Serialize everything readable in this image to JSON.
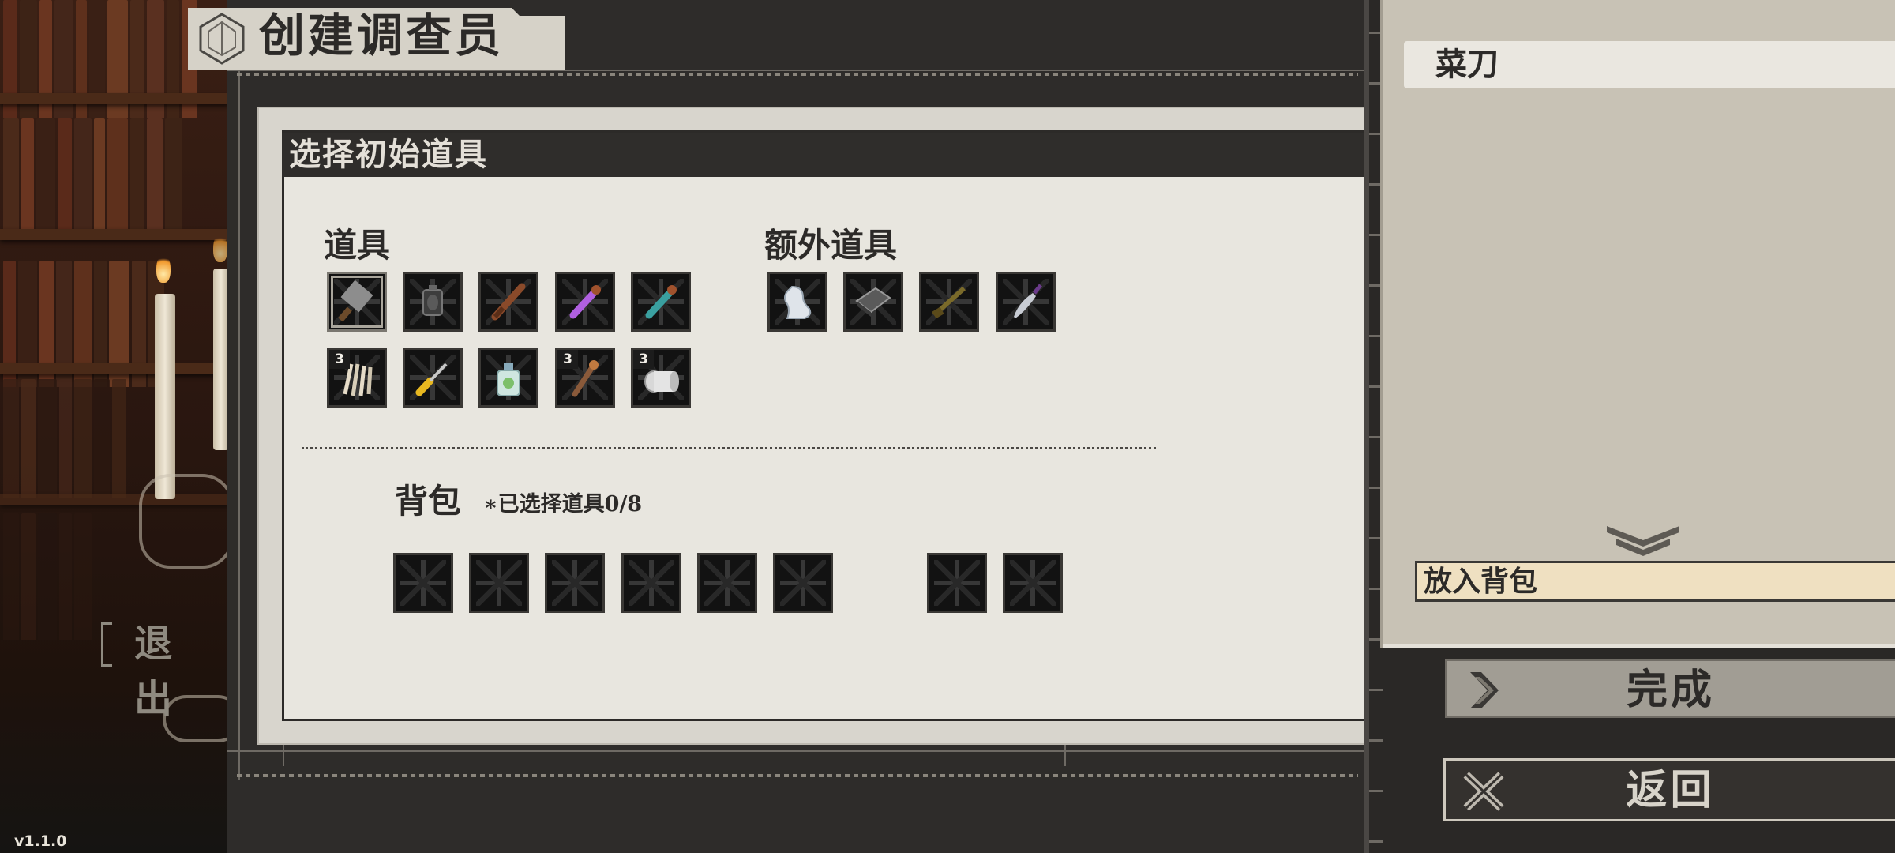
{
  "header": {
    "title": "创建调查员"
  },
  "left": {
    "exit_label": "退出",
    "version": "v1.1.0"
  },
  "dialog": {
    "title": "选择初始道具",
    "items_label": "道具",
    "extra_items_label": "额外道具",
    "items": [
      {
        "name": "cleaver-icon",
        "badge": ""
      },
      {
        "name": "lantern-icon",
        "badge": ""
      },
      {
        "name": "wooden-club-icon",
        "badge": ""
      },
      {
        "name": "purple-potion-vial-icon",
        "badge": ""
      },
      {
        "name": "teal-potion-vial-icon",
        "badge": ""
      },
      {
        "name": "candles-bundle-icon",
        "badge": "3"
      },
      {
        "name": "screwdriver-icon",
        "badge": ""
      },
      {
        "name": "oil-bottle-icon",
        "badge": ""
      },
      {
        "name": "torch-icon",
        "badge": "3"
      },
      {
        "name": "bandage-roll-icon",
        "badge": "3"
      }
    ],
    "extra_items": [
      {
        "name": "ghost-figure-icon"
      },
      {
        "name": "book-icon"
      },
      {
        "name": "shotgun-icon"
      },
      {
        "name": "knife-icon"
      }
    ],
    "bag_label": "背包",
    "bag_count": "∗已选择道具0/8",
    "bag_slots": 8
  },
  "detail": {
    "selected_item": "菜刀",
    "put_in_bag": "放入背包"
  },
  "buttons": {
    "done": "完成",
    "back": "返回"
  },
  "colors": {
    "panel_bg": "#e8e6df",
    "header_dark": "#2f2d2b",
    "highlight": "#efe0c1"
  }
}
